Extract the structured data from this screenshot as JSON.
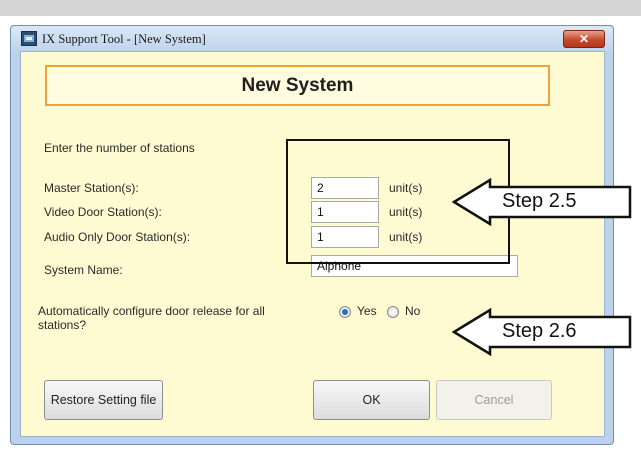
{
  "window": {
    "title": "IX Support Tool - [New System]",
    "close_symbol": "✕"
  },
  "header": {
    "title": "New System"
  },
  "form": {
    "intro": "Enter the number of stations",
    "master_label": "Master Station(s):",
    "master_value": "2",
    "video_door_label": "Video Door Station(s):",
    "video_door_value": "1",
    "audio_door_label": "Audio Only Door Station(s):",
    "audio_door_value": "1",
    "unit_label": "unit(s)",
    "system_name_label": "System Name:",
    "system_name_value": "Aiphone",
    "door_release_question_line1": "Automatically configure door release for all",
    "door_release_question_line2": "stations?",
    "yes_label": "Yes",
    "no_label": "No",
    "selected": "Yes"
  },
  "buttons": {
    "restore": "Restore Setting file",
    "ok": "OK",
    "cancel": "Cancel"
  },
  "annotations": {
    "step_a": "Step 2.5",
    "step_b": "Step 2.6"
  },
  "icons": [
    "app-icon",
    "close-icon",
    "arrow-callout-icon"
  ]
}
